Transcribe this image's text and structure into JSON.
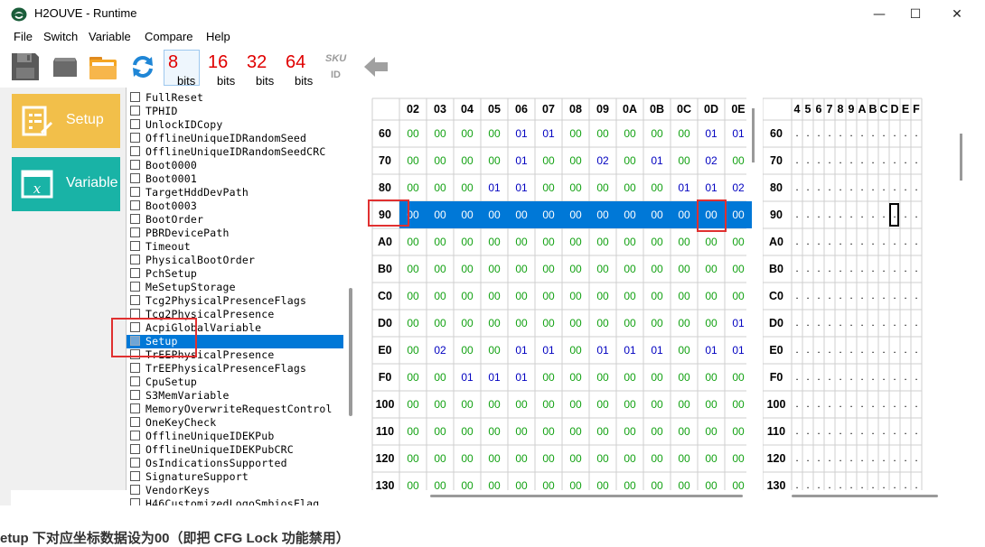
{
  "window": {
    "title": "H2OUVE - Runtime",
    "minimize": "—",
    "maximize": "☐",
    "close": "✕"
  },
  "menu": [
    "File",
    "Switch",
    "Variable",
    "Compare",
    "Help"
  ],
  "toolbar": {
    "bits": [
      {
        "num": "8",
        "label": "bits"
      },
      {
        "num": "16",
        "label": "bits"
      },
      {
        "num": "32",
        "label": "bits"
      },
      {
        "num": "64",
        "label": "bits"
      }
    ],
    "sku_label": "SKU",
    "id_label": "ID"
  },
  "side_buttons": [
    {
      "label": "Setup",
      "color": "#f2bf4a"
    },
    {
      "label": "Variable",
      "color": "#19b3a6"
    }
  ],
  "variables": [
    "FullReset",
    "TPHID",
    "UnlockIDCopy",
    "OfflineUniqueIDRandomSeed",
    "OfflineUniqueIDRandomSeedCRC",
    "Boot0000",
    "Boot0001",
    "TargetHddDevPath",
    "Boot0003",
    "BootOrder",
    "PBRDevicePath",
    "Timeout",
    "PhysicalBootOrder",
    "PchSetup",
    "MeSetupStorage",
    "Tcg2PhysicalPresenceFlags",
    "Tcg2PhysicalPresence",
    "AcpiGlobalVariable",
    "Setup",
    "TrEEPhysicalPresence",
    "TrEEPhysicalPresenceFlags",
    "CpuSetup",
    "S3MemVariable",
    "MemoryOverwriteRequestControl",
    "OneKeyCheck",
    "OfflineUniqueIDEKPub",
    "OfflineUniqueIDEKPubCRC",
    "OsIndicationsSupported",
    "SignatureSupport",
    "VendorKeys",
    "H46CustomizedLogoSmbiosFlag"
  ],
  "selected_variable": "Setup",
  "hex": {
    "columns": [
      "02",
      "03",
      "04",
      "05",
      "06",
      "07",
      "08",
      "09",
      "0A",
      "0B",
      "0C",
      "0D",
      "0E"
    ],
    "rows": [
      {
        "addr": "60",
        "cells": [
          "00",
          "00",
          "00",
          "00",
          "01",
          "01",
          "00",
          "00",
          "00",
          "00",
          "00",
          "01",
          "01"
        ]
      },
      {
        "addr": "70",
        "cells": [
          "00",
          "00",
          "00",
          "00",
          "01",
          "00",
          "00",
          "02",
          "00",
          "01",
          "00",
          "02",
          "00"
        ]
      },
      {
        "addr": "80",
        "cells": [
          "00",
          "00",
          "00",
          "01",
          "01",
          "00",
          "00",
          "00",
          "00",
          "00",
          "01",
          "01",
          "02"
        ]
      },
      {
        "addr": "90",
        "cells": [
          "00",
          "00",
          "00",
          "00",
          "00",
          "00",
          "00",
          "00",
          "00",
          "00",
          "00",
          "00",
          "00"
        ]
      },
      {
        "addr": "A0",
        "cells": [
          "00",
          "00",
          "00",
          "00",
          "00",
          "00",
          "00",
          "00",
          "00",
          "00",
          "00",
          "00",
          "00"
        ]
      },
      {
        "addr": "B0",
        "cells": [
          "00",
          "00",
          "00",
          "00",
          "00",
          "00",
          "00",
          "00",
          "00",
          "00",
          "00",
          "00",
          "00"
        ]
      },
      {
        "addr": "C0",
        "cells": [
          "00",
          "00",
          "00",
          "00",
          "00",
          "00",
          "00",
          "00",
          "00",
          "00",
          "00",
          "00",
          "00"
        ]
      },
      {
        "addr": "D0",
        "cells": [
          "00",
          "00",
          "00",
          "00",
          "00",
          "00",
          "00",
          "00",
          "00",
          "00",
          "00",
          "00",
          "01"
        ]
      },
      {
        "addr": "E0",
        "cells": [
          "00",
          "02",
          "00",
          "00",
          "01",
          "01",
          "00",
          "01",
          "01",
          "01",
          "00",
          "01",
          "01"
        ]
      },
      {
        "addr": "F0",
        "cells": [
          "00",
          "00",
          "01",
          "01",
          "01",
          "00",
          "00",
          "00",
          "00",
          "00",
          "00",
          "00",
          "00"
        ]
      },
      {
        "addr": "100",
        "cells": [
          "00",
          "00",
          "00",
          "00",
          "00",
          "00",
          "00",
          "00",
          "00",
          "00",
          "00",
          "00",
          "00"
        ]
      },
      {
        "addr": "110",
        "cells": [
          "00",
          "00",
          "00",
          "00",
          "00",
          "00",
          "00",
          "00",
          "00",
          "00",
          "00",
          "00",
          "00"
        ]
      },
      {
        "addr": "120",
        "cells": [
          "00",
          "00",
          "00",
          "00",
          "00",
          "00",
          "00",
          "00",
          "00",
          "00",
          "00",
          "00",
          "00"
        ]
      },
      {
        "addr": "130",
        "cells": [
          "00",
          "00",
          "00",
          "00",
          "00",
          "00",
          "00",
          "00",
          "00",
          "00",
          "00",
          "00",
          "00"
        ]
      }
    ],
    "selected_row": "90",
    "zero_color": "#14a214",
    "nonzero_color": "#0000c0",
    "selection_color": "#0078d7"
  },
  "ascii": {
    "columns": [
      "4",
      "5",
      "6",
      "7",
      "8",
      "9",
      "A",
      "B",
      "C",
      "D",
      "E",
      "F"
    ],
    "rows": [
      "60",
      "70",
      "80",
      "90",
      "A0",
      "B0",
      "C0",
      "D0",
      "E0",
      "F0",
      "100",
      "110",
      "120",
      "130"
    ],
    "cell_char": ".",
    "cursor_row": "90",
    "cursor_col": "D"
  },
  "bottom_text": "etup 下对应坐标数据设为00（即把 CFG Lock 功能禁用）"
}
